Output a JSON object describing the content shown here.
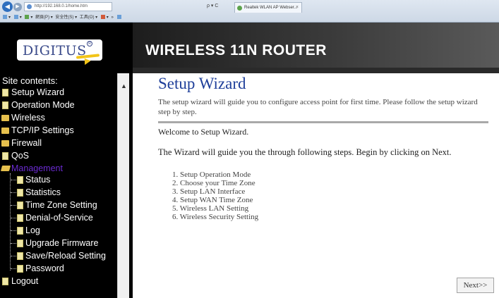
{
  "browser": {
    "url": "http://192.168.0.1/home.htm",
    "search_controls": "ρ ▾ C",
    "tab_title": "Realtek WLAN AP Webser...",
    "tab_close": "×",
    "toolbar_items": [
      "▾",
      "▾",
      "▾",
      "網頁(P) ▾",
      "安全性(S) ▾",
      "工具(O) ▾",
      "▾",
      "»"
    ],
    "toolbar_colors": [
      "#6a9fd8",
      "#6a9fd8",
      "#5da34c",
      "#d25a3a",
      "#6a9fd8"
    ]
  },
  "header": {
    "logo_text": "DIGITUS",
    "logo_reg": "R",
    "banner_title": "WIRELESS 11N ROUTER",
    "accent_color": "#f2c418"
  },
  "sidebar": {
    "title": "Site contents:",
    "items": [
      {
        "label": "Setup Wizard",
        "icon": "doc-icon"
      },
      {
        "label": "Operation Mode",
        "icon": "doc-icon"
      },
      {
        "label": "Wireless",
        "icon": "folder-icon"
      },
      {
        "label": "TCP/IP Settings",
        "icon": "folder-icon"
      },
      {
        "label": "Firewall",
        "icon": "folder-icon"
      },
      {
        "label": "QoS",
        "icon": "doc-icon"
      },
      {
        "label": "Management",
        "icon": "folder-open-icon",
        "active": true,
        "color": "#6a2ad0"
      },
      {
        "label": "Status",
        "icon": "doc-icon"
      },
      {
        "label": "Statistics",
        "icon": "doc-icon"
      },
      {
        "label": "Time Zone Setting",
        "icon": "doc-icon"
      },
      {
        "label": "Denial-of-Service",
        "icon": "doc-icon"
      },
      {
        "label": "Log",
        "icon": "doc-icon"
      },
      {
        "label": "Upgrade Firmware",
        "icon": "doc-icon"
      },
      {
        "label": "Save/Reload Setting",
        "icon": "doc-icon"
      },
      {
        "label": "Password",
        "icon": "doc-icon"
      },
      {
        "label": "Logout",
        "icon": "doc-icon"
      }
    ]
  },
  "main": {
    "title": "Setup Wizard",
    "title_color": "#1f3f9a",
    "intro": "The setup wizard will guide you to configure access point for first time. Please follow the setup wizard step by step.",
    "welcome": "Welcome to Setup Wizard.",
    "guide": "The Wizard will guide you the through following steps. Begin by clicking on Next.",
    "steps": [
      "1.  Setup Operation Mode",
      "2.  Choose your Time Zone",
      "3.  Setup LAN Interface",
      "4.  Setup WAN Time Zone",
      "5.  Wireless LAN Setting",
      "6.  Wireless Security Setting"
    ],
    "next_label": "Next>>"
  }
}
